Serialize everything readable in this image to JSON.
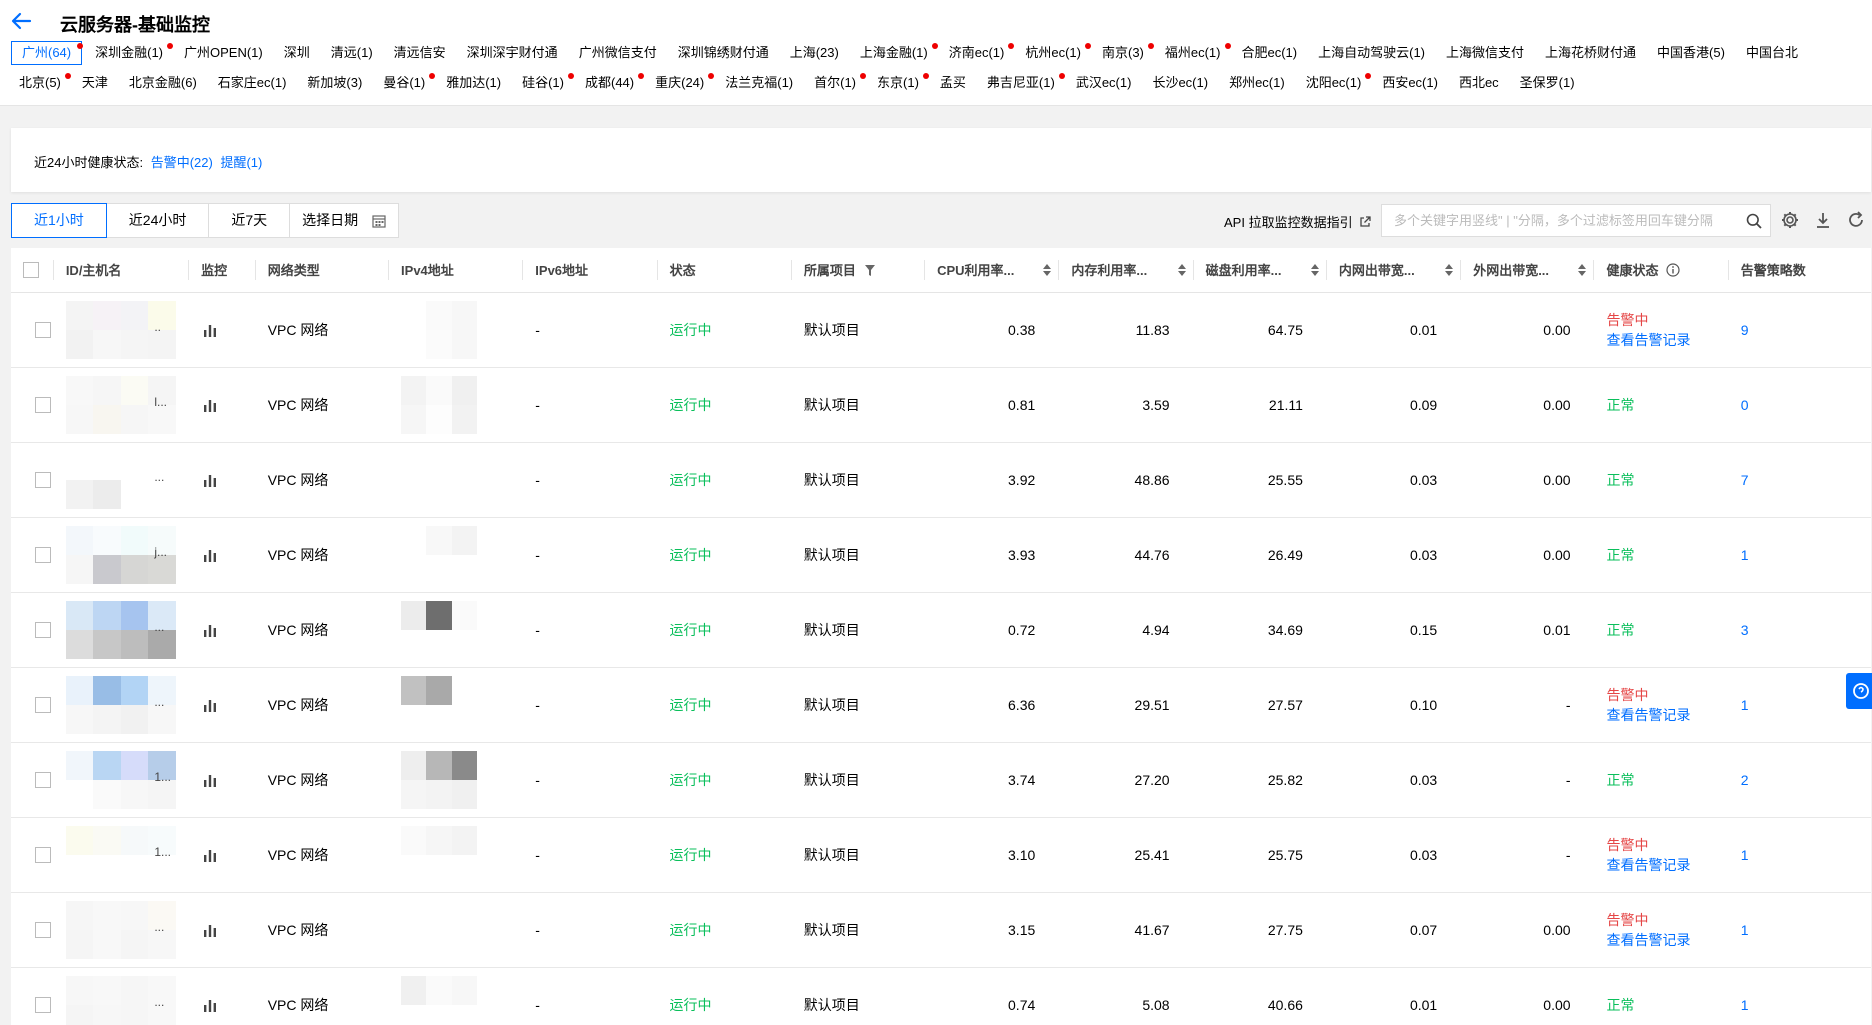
{
  "header": {
    "title": "云服务器-基础监控",
    "regions_row1": [
      {
        "label": "广州(64)",
        "active": true,
        "dot": true
      },
      {
        "label": "深圳金融(1)",
        "dot": true
      },
      {
        "label": "广州OPEN(1)",
        "dot": false
      },
      {
        "label": "深圳",
        "dot": false
      },
      {
        "label": "清远(1)",
        "dot": false
      },
      {
        "label": "清远信安",
        "dot": false
      },
      {
        "label": "深圳深宇财付通",
        "dot": false
      },
      {
        "label": "广州微信支付",
        "dot": false
      },
      {
        "label": "深圳锦绣财付通",
        "dot": false
      },
      {
        "label": "上海(23)",
        "dot": false
      },
      {
        "label": "上海金融(1)",
        "dot": true
      },
      {
        "label": "济南ec(1)",
        "dot": true
      },
      {
        "label": "杭州ec(1)",
        "dot": true
      },
      {
        "label": "南京(3)",
        "dot": true
      },
      {
        "label": "福州ec(1)",
        "dot": true
      },
      {
        "label": "合肥ec(1)",
        "dot": false
      },
      {
        "label": "上海自动驾驶云(1)",
        "dot": false
      },
      {
        "label": "上海微信支付",
        "dot": false
      },
      {
        "label": "上海花桥财付通",
        "dot": false
      },
      {
        "label": "中国香港(5)",
        "dot": false
      },
      {
        "label": "中国台北",
        "dot": false
      }
    ],
    "regions_row2": [
      {
        "label": "北京(5)",
        "dot": true
      },
      {
        "label": "天津",
        "dot": false
      },
      {
        "label": "北京金融(6)",
        "dot": false
      },
      {
        "label": "石家庄ec(1)",
        "dot": false
      },
      {
        "label": "新加坡(3)",
        "dot": false
      },
      {
        "label": "曼谷(1)",
        "dot": true
      },
      {
        "label": "雅加达(1)",
        "dot": false
      },
      {
        "label": "硅谷(1)",
        "dot": true
      },
      {
        "label": "成都(44)",
        "dot": true
      },
      {
        "label": "重庆(24)",
        "dot": true
      },
      {
        "label": "法兰克福(1)",
        "dot": false
      },
      {
        "label": "首尔(1)",
        "dot": true
      },
      {
        "label": "东京(1)",
        "dot": true
      },
      {
        "label": "孟买",
        "dot": false
      },
      {
        "label": "弗吉尼亚(1)",
        "dot": true
      },
      {
        "label": "武汉ec(1)",
        "dot": false
      },
      {
        "label": "长沙ec(1)",
        "dot": false
      },
      {
        "label": "郑州ec(1)",
        "dot": false
      },
      {
        "label": "沈阳ec(1)",
        "dot": true
      },
      {
        "label": "西安ec(1)",
        "dot": false
      },
      {
        "label": "西北ec",
        "dot": false
      },
      {
        "label": "圣保罗(1)",
        "dot": false
      }
    ]
  },
  "health": {
    "label": "近24小时健康状态:",
    "alarm": "告警中(22)",
    "remind": "提醒(1)"
  },
  "toolbar": {
    "time_1h": "近1小时",
    "time_24h": "近24小时",
    "time_7d": "近7天",
    "date_pick": "选择日期",
    "api_link": "API 拉取监控数据指引",
    "search_placeholder": "多个关键字用竖线\" | \"分隔，多个过滤标签用回车键分隔"
  },
  "table": {
    "headers": {
      "id": "ID/主机名",
      "monitor": "监控",
      "network": "网络类型",
      "ipv4": "IPv4地址",
      "ipv6": "IPv6地址",
      "status": "状态",
      "project": "所属项目",
      "cpu": "CPU利用率...",
      "mem": "内存利用率...",
      "disk": "磁盘利用率...",
      "lan_out": "内网出带宽...",
      "wan_out": "外网出带宽...",
      "health": "健康状态",
      "policies": "告警策略数"
    },
    "rows": [
      {
        "network": "VPC 网络",
        "ipv6": "-",
        "status": "运行中",
        "project": "默认项目",
        "cpu": "0.38",
        "mem": "11.83",
        "disk": "64.75",
        "lan": "0.01",
        "wan": "0.00",
        "health": "告警中",
        "alarm": true,
        "link": "查看告警记录",
        "policies": "9",
        "ell": "..",
        "id_blur": [
          "#f4f4f4",
          "#f6f2f6",
          "#f3f3f6",
          "#fbfbea",
          "#f2f2f2",
          "#f7f7f7",
          "#f5f5f5",
          "#f4f4f4"
        ],
        "ip_blur": [
          "#fff",
          "#fafafa",
          "#f7f7f7",
          "#fff",
          "#fbfbfb",
          "#f7f7f7"
        ]
      },
      {
        "network": "VPC 网络",
        "ipv6": "-",
        "status": "运行中",
        "project": "默认项目",
        "cpu": "0.81",
        "mem": "3.59",
        "disk": "21.11",
        "lan": "0.09",
        "wan": "0.00",
        "health": "正常",
        "alarm": false,
        "link": "",
        "policies": "0",
        "ell": "l...",
        "id_blur": [
          "#f8f8f8",
          "#f6f6f6",
          "#fbfbf4",
          "#f5f5f5",
          "#f7f7f7",
          "#f8f6f0",
          "#f6f6f6",
          "#f8f8f8"
        ],
        "ip_blur": [
          "#f3f3f3",
          "#fafafa",
          "#f0f0f0",
          "#f6f6f6",
          "#fdfdfd",
          "#f2f2f2"
        ]
      },
      {
        "network": "VPC 网络",
        "ipv6": "-",
        "status": "运行中",
        "project": "默认项目",
        "cpu": "3.92",
        "mem": "48.86",
        "disk": "25.55",
        "lan": "0.03",
        "wan": "0.00",
        "health": "正常",
        "alarm": false,
        "link": "",
        "policies": "7",
        "ell": "...",
        "id_blur": [
          "#fff",
          "#fff",
          "#fff",
          "#fff",
          "#f2f2f2",
          "#ececec",
          "#fff",
          "#fff"
        ],
        "ip_blur": [
          "#fff",
          "#fff",
          "#fff",
          "#fff",
          "#fff",
          "#fff"
        ]
      },
      {
        "network": "VPC 网络",
        "ipv6": "-",
        "status": "运行中",
        "project": "默认项目",
        "cpu": "3.93",
        "mem": "44.76",
        "disk": "26.49",
        "lan": "0.03",
        "wan": "0.00",
        "health": "正常",
        "alarm": false,
        "link": "",
        "policies": "1",
        "ell": "j...",
        "id_blur": [
          "#f3f7fb",
          "#f8fbfd",
          "#f1fbfb",
          "#f6fbfb",
          "#f6f6f6",
          "#c9c9ce",
          "#d6d6d4",
          "#d9d9d6"
        ],
        "ip_blur": [
          "#fff",
          "#f8f8f8",
          "#f3f3f3",
          "#fff",
          "#fff",
          "#fff"
        ]
      },
      {
        "network": "VPC 网络",
        "ipv6": "-",
        "status": "运行中",
        "project": "默认项目",
        "cpu": "0.72",
        "mem": "4.94",
        "disk": "34.69",
        "lan": "0.15",
        "wan": "0.01",
        "health": "正常",
        "alarm": false,
        "link": "",
        "policies": "3",
        "ell": "...",
        "id_blur": [
          "#d9e8f6",
          "#bdd6f3",
          "#a6c4ef",
          "#dbe9f7",
          "#dcdcdc",
          "#c7c7c7",
          "#bdbdbd",
          "#aaaaaa"
        ],
        "ip_blur": [
          "#ececec",
          "#6e6e6e",
          "#fafafa",
          "#fff",
          "#fff",
          "#fff"
        ]
      },
      {
        "network": "VPC 网络",
        "ipv6": "-",
        "status": "运行中",
        "project": "默认项目",
        "cpu": "6.36",
        "mem": "29.51",
        "disk": "27.57",
        "lan": "0.10",
        "wan": "-",
        "health": "告警中",
        "alarm": true,
        "link": "查看告警记录",
        "policies": "1",
        "ell": "...",
        "id_blur": [
          "#e9f2fb",
          "#98bde6",
          "#b2d4f5",
          "#eef5fb",
          "#f7f7f7",
          "#f4f4f4",
          "#f1f1f1",
          "#f7f7f7"
        ],
        "ip_blur": [
          "#c1c1c1",
          "#a9a9a9",
          "#fff",
          "#fff",
          "#fff",
          "#fff"
        ]
      },
      {
        "network": "VPC 网络",
        "ipv6": "-",
        "status": "运行中",
        "project": "默认项目",
        "cpu": "3.74",
        "mem": "27.20",
        "disk": "25.82",
        "lan": "0.03",
        "wan": "-",
        "health": "正常",
        "alarm": false,
        "link": "",
        "policies": "2",
        "ell": "1...",
        "id_blur": [
          "#f1f6fb",
          "#b9d6f3",
          "#d6dcfa",
          "#b6cde9",
          "#fff",
          "#fafafa",
          "#f7f7f7",
          "#f5f5f5"
        ],
        "ip_blur": [
          "#eeeeee",
          "#b7b7b7",
          "#8a8a8a",
          "#f5f5f5",
          "#f3f3f3",
          "#f0f0f0"
        ]
      },
      {
        "network": "VPC 网络",
        "ipv6": "-",
        "status": "运行中",
        "project": "默认项目",
        "cpu": "3.10",
        "mem": "25.41",
        "disk": "25.75",
        "lan": "0.03",
        "wan": "-",
        "health": "告警中",
        "alarm": true,
        "link": "查看告警记录",
        "policies": "1",
        "ell": "1...",
        "id_blur": [
          "#fbfbee",
          "#fafaf4",
          "#f6f9fa",
          "#f7fbfc",
          "#fff",
          "#fff",
          "#fff",
          "#fff"
        ],
        "ip_blur": [
          "#fafafa",
          "#f6f6f6",
          "#f3f3f3",
          "#fff",
          "#fff",
          "#fff"
        ]
      },
      {
        "network": "VPC 网络",
        "ipv6": "-",
        "status": "运行中",
        "project": "默认项目",
        "cpu": "3.15",
        "mem": "41.67",
        "disk": "27.75",
        "lan": "0.07",
        "wan": "0.00",
        "health": "告警中",
        "alarm": true,
        "link": "查看告警记录",
        "policies": "1",
        "ell": "...",
        "id_blur": [
          "#f6f6f6",
          "#f8f8f8",
          "#f7f7f7",
          "#fbf9f4",
          "#f5f5f5",
          "#f8f8f8",
          "#f5f5f5",
          "#f7f7f7"
        ],
        "ip_blur": [
          "#fff",
          "#fff",
          "#fff",
          "#fff",
          "#fff",
          "#fff"
        ]
      },
      {
        "network": "VPC 网络",
        "ipv6": "-",
        "status": "运行中",
        "project": "默认项目",
        "cpu": "0.74",
        "mem": "5.08",
        "disk": "40.66",
        "lan": "0.01",
        "wan": "0.00",
        "health": "正常",
        "alarm": false,
        "link": "",
        "policies": "1",
        "ell": "...",
        "id_blur": [
          "#f7f7f7",
          "#f8f8f8",
          "#f6f6f6",
          "#f8f8f8",
          "#f5f5f5",
          "#f7f7f7",
          "#f6f6f6",
          "#f8f8f8"
        ],
        "ip_blur": [
          "#f0f0f0",
          "#fafafa",
          "#f7f7f7",
          "#fff",
          "#fff",
          "#fff"
        ]
      }
    ]
  }
}
